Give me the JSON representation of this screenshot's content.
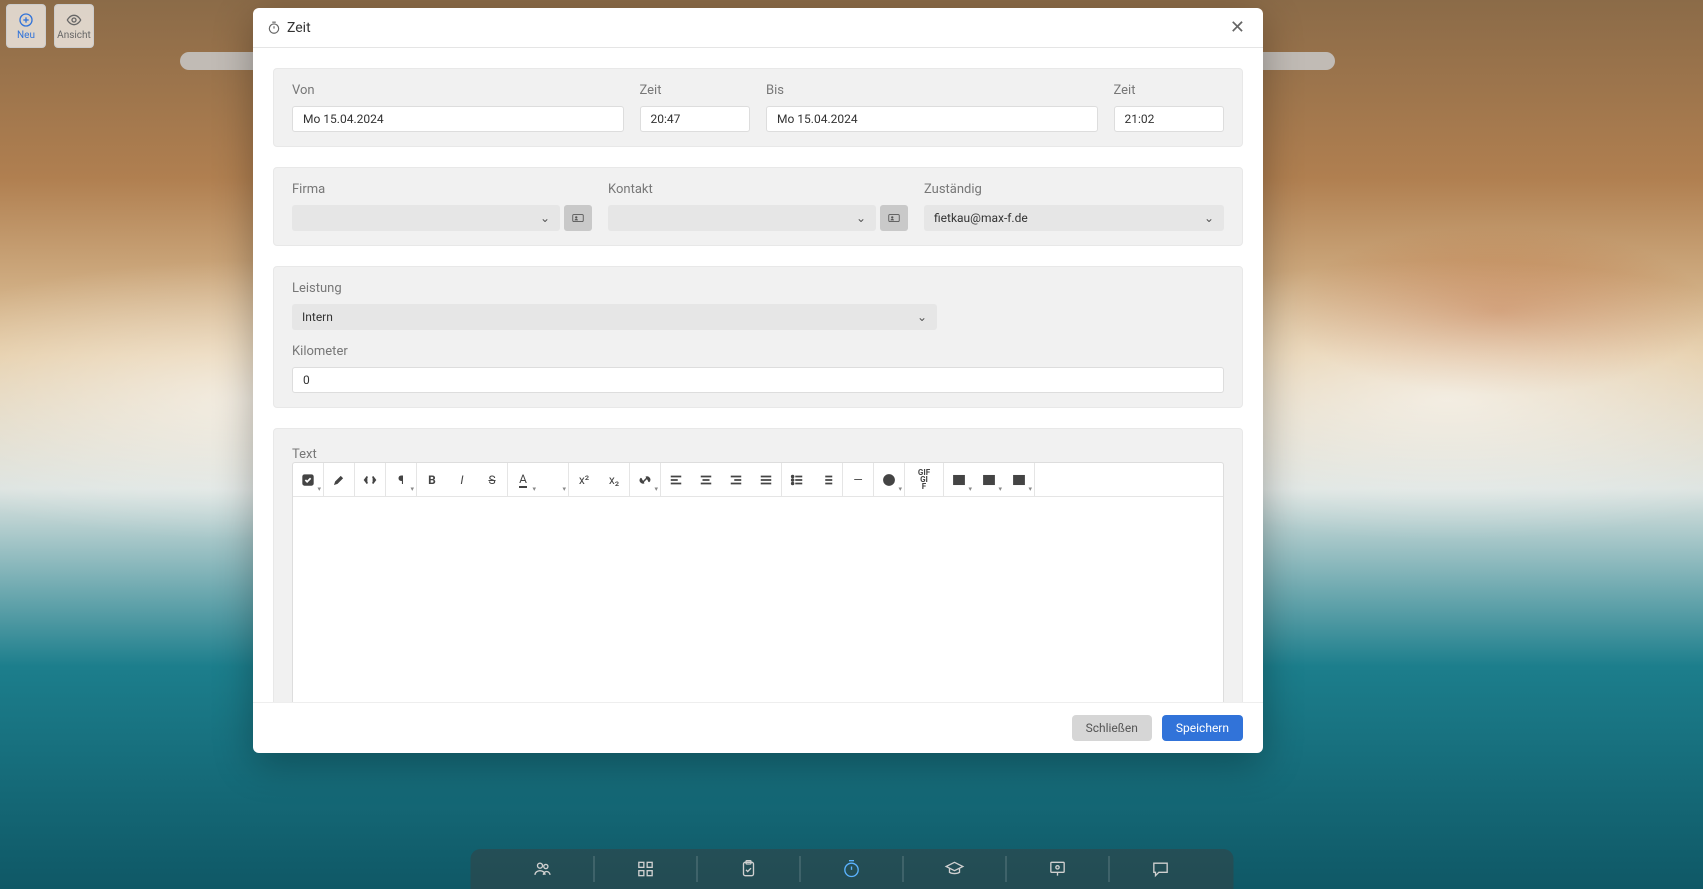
{
  "top_buttons": {
    "new": "Neu",
    "view": "Ansicht"
  },
  "modal": {
    "title": "Zeit",
    "sections": {
      "time": {
        "von_label": "Von",
        "von_value": "Mo 15.04.2024",
        "zeit1_label": "Zeit",
        "zeit1_value": "20:47",
        "bis_label": "Bis",
        "bis_value": "Mo 15.04.2024",
        "zeit2_label": "Zeit",
        "zeit2_value": "21:02"
      },
      "party": {
        "firma_label": "Firma",
        "firma_value": "",
        "kontakt_label": "Kontakt",
        "kontakt_value": "",
        "zustaendig_label": "Zuständig",
        "zustaendig_value": "fietkau@max-f.de"
      },
      "service": {
        "leistung_label": "Leistung",
        "leistung_value": "Intern",
        "kilometer_label": "Kilometer",
        "kilometer_value": "0"
      },
      "text": {
        "label": "Text"
      }
    },
    "footer": {
      "close": "Schließen",
      "save": "Speichern"
    }
  },
  "editor_toolbar": {
    "gif": "GIF\nGI\nF"
  }
}
